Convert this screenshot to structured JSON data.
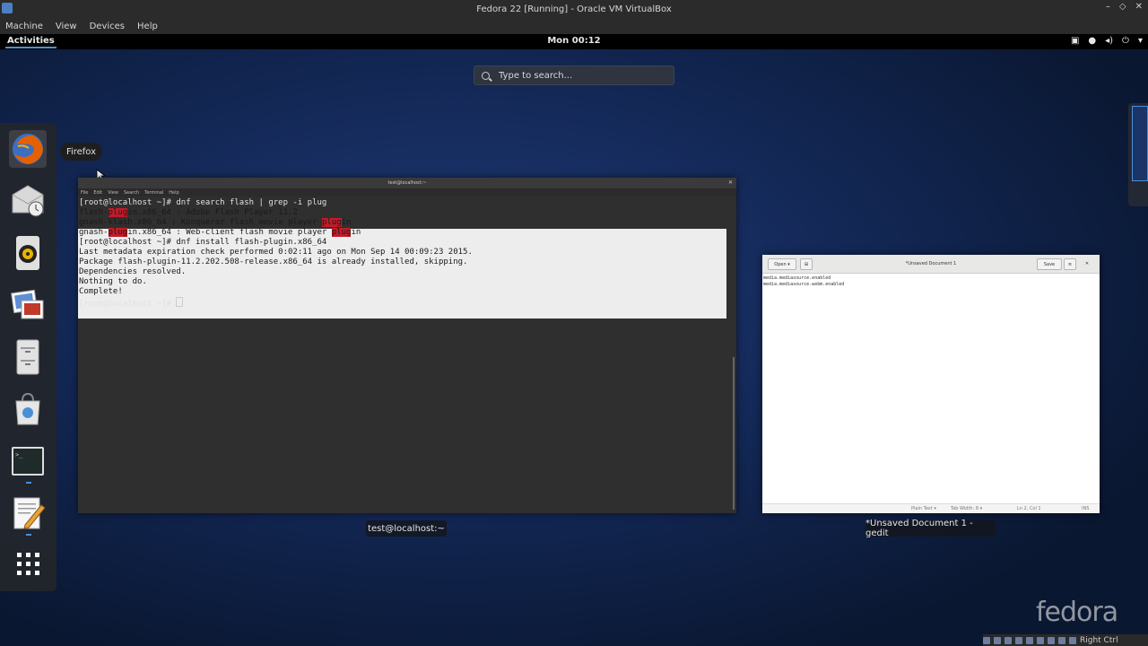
{
  "vbox": {
    "title": "Fedora 22 [Running] - Oracle VM VirtualBox",
    "menu": [
      "Machine",
      "View",
      "Devices",
      "Help"
    ],
    "window_buttons": [
      "–",
      "◇",
      "✕"
    ],
    "status_host_key": "Right Ctrl"
  },
  "topbar": {
    "activities": "Activities",
    "clock": "Mon 00:12",
    "tray_icons": [
      "screen-icon",
      "mic-icon",
      "volume-icon",
      "power-icon",
      "chevron-down-icon"
    ]
  },
  "search": {
    "placeholder": "Type to search..."
  },
  "dash": {
    "tooltip": "Firefox",
    "items": [
      "firefox-icon",
      "evolution-icon",
      "rhythmbox-icon",
      "shotwell-icon",
      "files-icon",
      "software-icon",
      "terminal-icon",
      "gedit-icon",
      "show-apps-icon"
    ]
  },
  "terminal": {
    "title": "test@localhost:~",
    "menu": [
      "File",
      "Edit",
      "View",
      "Search",
      "Terminal",
      "Help"
    ],
    "caption": "test@localhost:~",
    "lines": {
      "l1": "[root@localhost ~]# dnf search flash | grep -i plug",
      "l2a": "flash-",
      "l2b": "plug",
      "l2c": "in.x86_64 : Adobe Flash Player 11.2",
      "l3a": "gnash-klash.x86_64 : Konqueror flash movie player ",
      "l3b": "plug",
      "l3c": "in",
      "l4a": "gnash-",
      "l4b": "plug",
      "l4c": "in.x86_64 : Web-client flash movie player ",
      "l4d": "plug",
      "l4e": "in",
      "l5": "[root@localhost ~]# dnf install flash-plugin.x86_64",
      "l6": "Last metadata expiration check performed 0:02:11 ago on Mon Sep 14 00:09:23 2015.",
      "l7": "Package flash-plugin-11.2.202.508-release.x86_64 is already installed, skipping.",
      "l8": "Dependencies resolved.",
      "l9": "Nothing to do.",
      "l10": "Complete!",
      "l11": "[root@localhost ~]# "
    }
  },
  "gedit": {
    "title": "*Unsaved Document 1",
    "open_label": "Open ▾",
    "save_label": "Save",
    "menu_icon": "≡",
    "close_icon": "✕",
    "text_lines": [
      "media.mediasource.enabled",
      "media.mediasource.webm.enabled"
    ],
    "status": {
      "mode": "Plain Text ▾",
      "tab": "Tab Width: 8 ▾",
      "pos": "Ln 2, Col 1",
      "ins": "INS"
    },
    "caption": "*Unsaved Document 1 - gedit"
  },
  "watermark": "fedora",
  "colors": {
    "highlight": "#c01c28",
    "accent": "#4a90d9"
  }
}
